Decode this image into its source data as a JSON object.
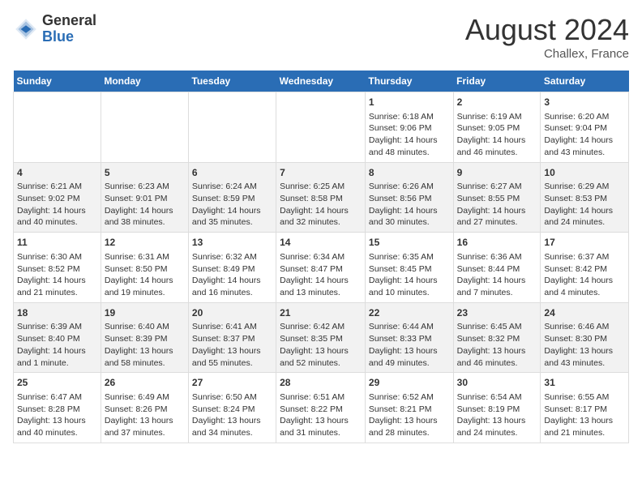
{
  "header": {
    "logo_line1": "General",
    "logo_line2": "Blue",
    "month": "August 2024",
    "location": "Challex, France"
  },
  "days_of_week": [
    "Sunday",
    "Monday",
    "Tuesday",
    "Wednesday",
    "Thursday",
    "Friday",
    "Saturday"
  ],
  "weeks": [
    [
      {
        "day": "",
        "content": ""
      },
      {
        "day": "",
        "content": ""
      },
      {
        "day": "",
        "content": ""
      },
      {
        "day": "",
        "content": ""
      },
      {
        "day": "1",
        "content": "Sunrise: 6:18 AM\nSunset: 9:06 PM\nDaylight: 14 hours and 48 minutes."
      },
      {
        "day": "2",
        "content": "Sunrise: 6:19 AM\nSunset: 9:05 PM\nDaylight: 14 hours and 46 minutes."
      },
      {
        "day": "3",
        "content": "Sunrise: 6:20 AM\nSunset: 9:04 PM\nDaylight: 14 hours and 43 minutes."
      }
    ],
    [
      {
        "day": "4",
        "content": "Sunrise: 6:21 AM\nSunset: 9:02 PM\nDaylight: 14 hours and 40 minutes."
      },
      {
        "day": "5",
        "content": "Sunrise: 6:23 AM\nSunset: 9:01 PM\nDaylight: 14 hours and 38 minutes."
      },
      {
        "day": "6",
        "content": "Sunrise: 6:24 AM\nSunset: 8:59 PM\nDaylight: 14 hours and 35 minutes."
      },
      {
        "day": "7",
        "content": "Sunrise: 6:25 AM\nSunset: 8:58 PM\nDaylight: 14 hours and 32 minutes."
      },
      {
        "day": "8",
        "content": "Sunrise: 6:26 AM\nSunset: 8:56 PM\nDaylight: 14 hours and 30 minutes."
      },
      {
        "day": "9",
        "content": "Sunrise: 6:27 AM\nSunset: 8:55 PM\nDaylight: 14 hours and 27 minutes."
      },
      {
        "day": "10",
        "content": "Sunrise: 6:29 AM\nSunset: 8:53 PM\nDaylight: 14 hours and 24 minutes."
      }
    ],
    [
      {
        "day": "11",
        "content": "Sunrise: 6:30 AM\nSunset: 8:52 PM\nDaylight: 14 hours and 21 minutes."
      },
      {
        "day": "12",
        "content": "Sunrise: 6:31 AM\nSunset: 8:50 PM\nDaylight: 14 hours and 19 minutes."
      },
      {
        "day": "13",
        "content": "Sunrise: 6:32 AM\nSunset: 8:49 PM\nDaylight: 14 hours and 16 minutes."
      },
      {
        "day": "14",
        "content": "Sunrise: 6:34 AM\nSunset: 8:47 PM\nDaylight: 14 hours and 13 minutes."
      },
      {
        "day": "15",
        "content": "Sunrise: 6:35 AM\nSunset: 8:45 PM\nDaylight: 14 hours and 10 minutes."
      },
      {
        "day": "16",
        "content": "Sunrise: 6:36 AM\nSunset: 8:44 PM\nDaylight: 14 hours and 7 minutes."
      },
      {
        "day": "17",
        "content": "Sunrise: 6:37 AM\nSunset: 8:42 PM\nDaylight: 14 hours and 4 minutes."
      }
    ],
    [
      {
        "day": "18",
        "content": "Sunrise: 6:39 AM\nSunset: 8:40 PM\nDaylight: 14 hours and 1 minute."
      },
      {
        "day": "19",
        "content": "Sunrise: 6:40 AM\nSunset: 8:39 PM\nDaylight: 13 hours and 58 minutes."
      },
      {
        "day": "20",
        "content": "Sunrise: 6:41 AM\nSunset: 8:37 PM\nDaylight: 13 hours and 55 minutes."
      },
      {
        "day": "21",
        "content": "Sunrise: 6:42 AM\nSunset: 8:35 PM\nDaylight: 13 hours and 52 minutes."
      },
      {
        "day": "22",
        "content": "Sunrise: 6:44 AM\nSunset: 8:33 PM\nDaylight: 13 hours and 49 minutes."
      },
      {
        "day": "23",
        "content": "Sunrise: 6:45 AM\nSunset: 8:32 PM\nDaylight: 13 hours and 46 minutes."
      },
      {
        "day": "24",
        "content": "Sunrise: 6:46 AM\nSunset: 8:30 PM\nDaylight: 13 hours and 43 minutes."
      }
    ],
    [
      {
        "day": "25",
        "content": "Sunrise: 6:47 AM\nSunset: 8:28 PM\nDaylight: 13 hours and 40 minutes."
      },
      {
        "day": "26",
        "content": "Sunrise: 6:49 AM\nSunset: 8:26 PM\nDaylight: 13 hours and 37 minutes."
      },
      {
        "day": "27",
        "content": "Sunrise: 6:50 AM\nSunset: 8:24 PM\nDaylight: 13 hours and 34 minutes."
      },
      {
        "day": "28",
        "content": "Sunrise: 6:51 AM\nSunset: 8:22 PM\nDaylight: 13 hours and 31 minutes."
      },
      {
        "day": "29",
        "content": "Sunrise: 6:52 AM\nSunset: 8:21 PM\nDaylight: 13 hours and 28 minutes."
      },
      {
        "day": "30",
        "content": "Sunrise: 6:54 AM\nSunset: 8:19 PM\nDaylight: 13 hours and 24 minutes."
      },
      {
        "day": "31",
        "content": "Sunrise: 6:55 AM\nSunset: 8:17 PM\nDaylight: 13 hours and 21 minutes."
      }
    ]
  ]
}
